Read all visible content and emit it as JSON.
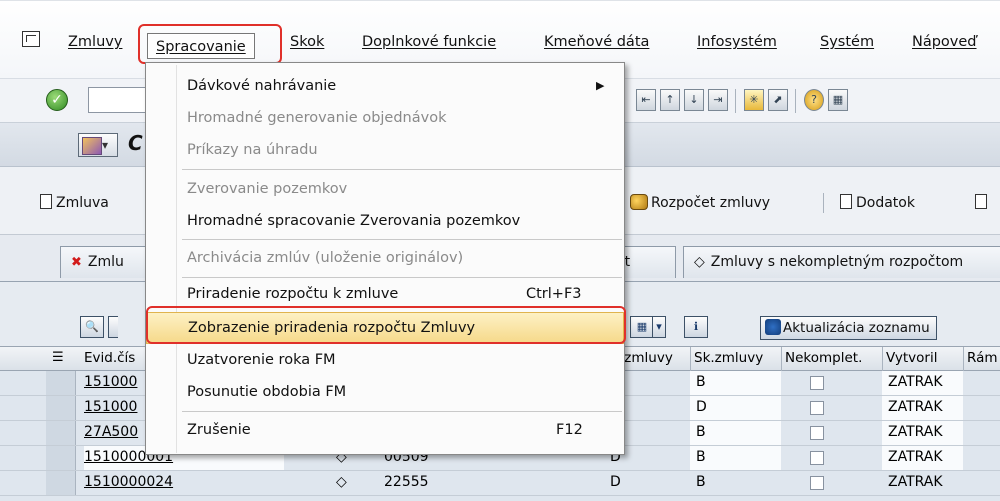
{
  "menubar": {
    "items": [
      {
        "label": "Zmluvy"
      },
      {
        "label": "Spracovanie"
      },
      {
        "label": "Skok"
      },
      {
        "label": "Doplnkové funkcie"
      },
      {
        "label": "Kmeňové dáta"
      },
      {
        "label": "Infosystém"
      },
      {
        "label": "Systém"
      },
      {
        "label": "Nápoveď"
      }
    ]
  },
  "title": {
    "text": "C"
  },
  "app_toolbar": {
    "zmluva": "Zmluva",
    "rozpocet": "Rozpočet zmluvy",
    "dodatok": "Dodatok"
  },
  "tabs": {
    "tab1": "Zmlu",
    "tab2_tail": "et",
    "tab3": "Zmluvy s nekompletným rozpočtom"
  },
  "grid_toolbar": {
    "refresh_label": "Aktualizácia zoznamu"
  },
  "table": {
    "columns": [
      "Evid.čís",
      ".zmluvy",
      "Sk.zmluvy",
      "Nekomplet.",
      "Vytvoril",
      "Rám"
    ],
    "rows": [
      {
        "evid": "151000",
        "col2": "",
        "col3": "",
        "col4": "",
        "sk": "B",
        "vytvoril": "ZATRAK"
      },
      {
        "evid": "151000",
        "col2": "",
        "col3": "",
        "col4": "",
        "sk": "D",
        "vytvoril": "ZATRAK"
      },
      {
        "evid": "27A500",
        "col2": "",
        "col3": "",
        "col4": "",
        "sk": "B",
        "vytvoril": "ZATRAK"
      },
      {
        "evid": "1510000001",
        "col2": "◇",
        "col3": "00509",
        "col4": "D",
        "sk": "B",
        "vytvoril": "ZATRAK"
      },
      {
        "evid": "1510000024",
        "col2": "◇",
        "col3": "22555",
        "col4": "D",
        "sk": "B",
        "vytvoril": "ZATRAK"
      }
    ]
  },
  "dropdown": {
    "items": [
      {
        "label": "Dávkové nahrávanie",
        "shortcut": "",
        "disabled": false
      },
      {
        "label": "Hromadné generovanie objednávok",
        "shortcut": "",
        "disabled": true
      },
      {
        "label": "Príkazy na úhradu",
        "shortcut": "",
        "disabled": true
      },
      {
        "label": "Zverovanie pozemkov",
        "shortcut": "",
        "disabled": true
      },
      {
        "label": "Hromadné spracovanie Zverovania pozemkov",
        "shortcut": "",
        "disabled": false
      },
      {
        "label": "Archivácia zmlúv (uloženie originálov)",
        "shortcut": "",
        "disabled": true
      },
      {
        "label": "Priradenie rozpočtu k zmluve",
        "shortcut": "Ctrl+F3",
        "disabled": false
      },
      {
        "label": "Zobrazenie priradenia rozpočtu Zmluvy",
        "shortcut": "",
        "disabled": false
      },
      {
        "label": "Uzatvorenie roka FM",
        "shortcut": "",
        "disabled": false
      },
      {
        "label": "Posunutie obdobia FM",
        "shortcut": "",
        "disabled": false
      },
      {
        "label": "Zrušenie",
        "shortcut": "F12",
        "disabled": false
      }
    ]
  },
  "colors": {
    "highlight_ring": "#e0302a",
    "menu_highlight": "#f6d98a"
  }
}
